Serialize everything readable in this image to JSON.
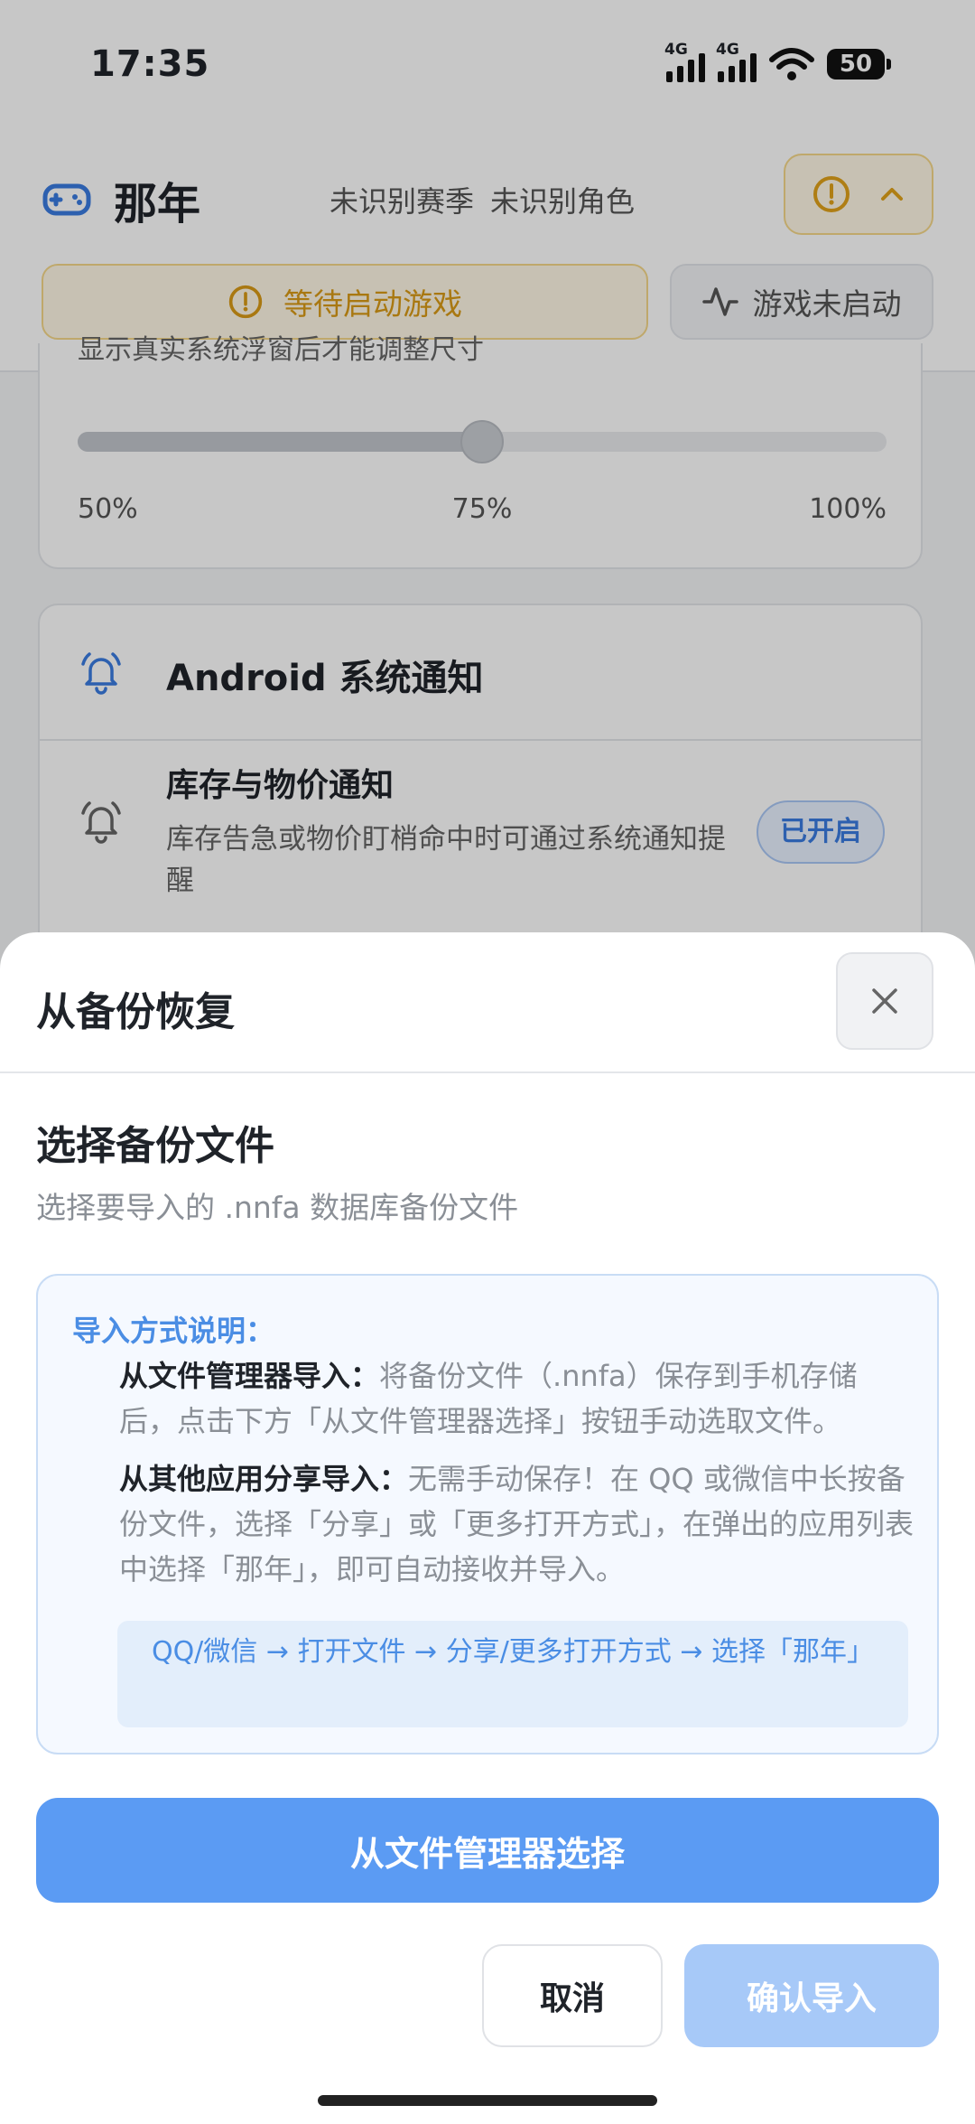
{
  "status_bar": {
    "time": "17:35",
    "network1": "4G",
    "network2": "4G",
    "battery": "50"
  },
  "header": {
    "app_name": "那年",
    "season": "未识别赛季",
    "character": "未识别角色",
    "status_waiting": "等待启动游戏",
    "game_status": "游戏未启动"
  },
  "display_card": {
    "hint": "显示真实系统浮窗后才能调整尺寸",
    "slider_value_percent": 75,
    "labels": [
      "50%",
      "75%",
      "100%"
    ]
  },
  "notify_card": {
    "title": "Android 系统通知",
    "row_title": "库存与物价通知",
    "row_desc": "库存告急或物价盯梢命中时可通过系统通知提醒",
    "badge": "已开启"
  },
  "sheet": {
    "title": "从备份恢复",
    "section_title": "选择备份文件",
    "section_subtitle": "选择要导入的 .nnfa 数据库备份文件",
    "info": {
      "heading": "导入方式说明：",
      "item1_label": "从文件管理器导入：",
      "item1_text": "将备份文件（.nnfa）保存到手机存储后，点击下方「从文件管理器选择」按钮手动选取文件。",
      "item2_label": "从其他应用分享导入：",
      "item2_text": "无需手动保存！在 QQ 或微信中长按备份文件，选择「分享」或「更多打开方式」，在弹出的应用列表中选择「那年」，即可自动接收并导入。",
      "flow": "QQ/微信 → 打开文件 → 分享/更多打开方式 → 选择「那年」"
    },
    "pick_button": "从文件管理器选择",
    "cancel_button": "取消",
    "confirm_button": "确认导入"
  },
  "colors": {
    "accent": "#5b9bf3",
    "accent_disabled": "#a7c9f8",
    "warning": "#e0a21a",
    "info_text": "#4a8de4"
  }
}
